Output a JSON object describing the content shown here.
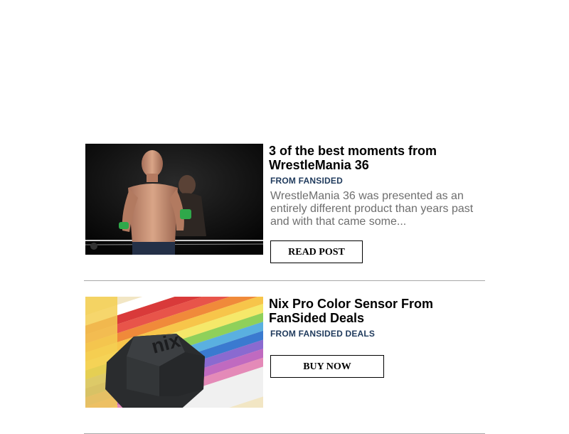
{
  "posts": [
    {
      "title": "3 of the best moments from WrestleMania 36",
      "source": "FROM FANSIDED",
      "excerpt": "WrestleMania 36 was presented as an entirely different product than years past and with that came some...",
      "cta": "READ POST",
      "image": "wrestler-photo"
    },
    {
      "title": "Nix Pro Color Sensor From FanSided Deals",
      "source": "FROM FANSIDED DEALS",
      "cta": "BUY NOW",
      "image": "color-sensor-photo",
      "sensor_logo": "nix"
    }
  ]
}
